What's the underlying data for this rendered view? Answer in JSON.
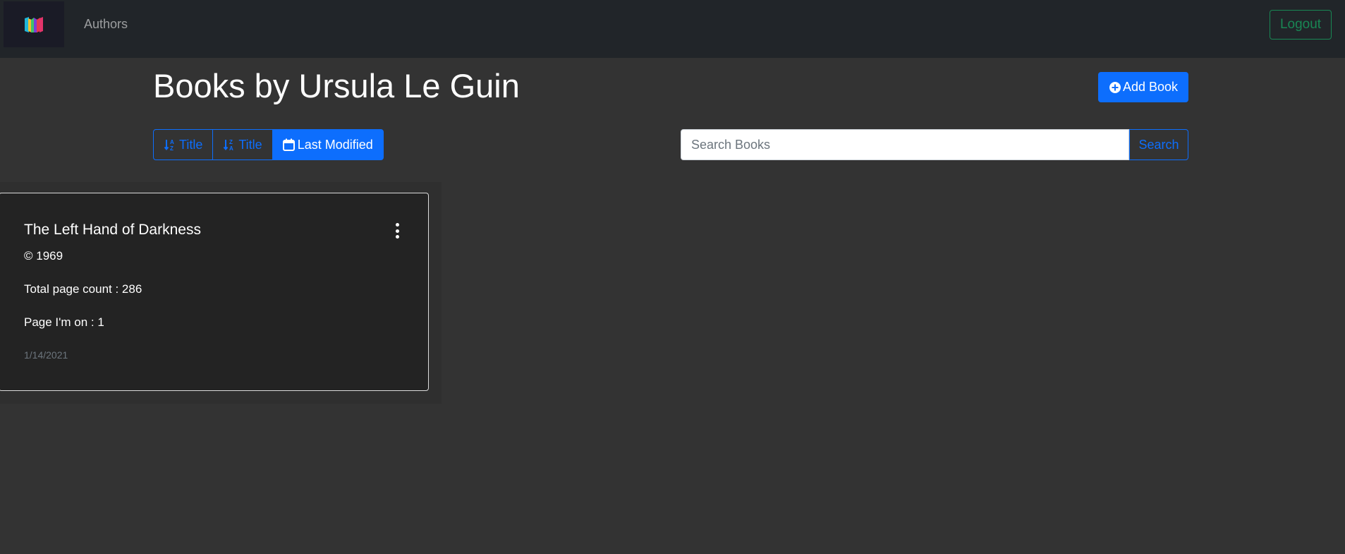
{
  "nav": {
    "logo_icon": "books-logo-icon",
    "authors_link": "Authors",
    "logout_label": "Logout"
  },
  "page": {
    "title": "Books by Ursula Le Guin",
    "add_book_label": "Add Book",
    "add_book_icon": "plus-circle-icon"
  },
  "sort": {
    "title_asc_label": "Title",
    "title_desc_label": "Title",
    "last_modified_label": "Last Modified",
    "active": "last_modified"
  },
  "search": {
    "placeholder": "Search Books",
    "value": "",
    "button_label": "Search"
  },
  "books": [
    {
      "title": "The Left Hand of Darkness",
      "copyright": "© 1969",
      "total_pages": "Total page count : 286",
      "current_page": "Page I'm on : 1",
      "modified": "1/14/2021"
    }
  ],
  "colors": {
    "primary": "#0d6efd",
    "success": "#198754",
    "navbar_bg": "#212529",
    "page_bg": "#333333",
    "card_bg": "#232323"
  }
}
